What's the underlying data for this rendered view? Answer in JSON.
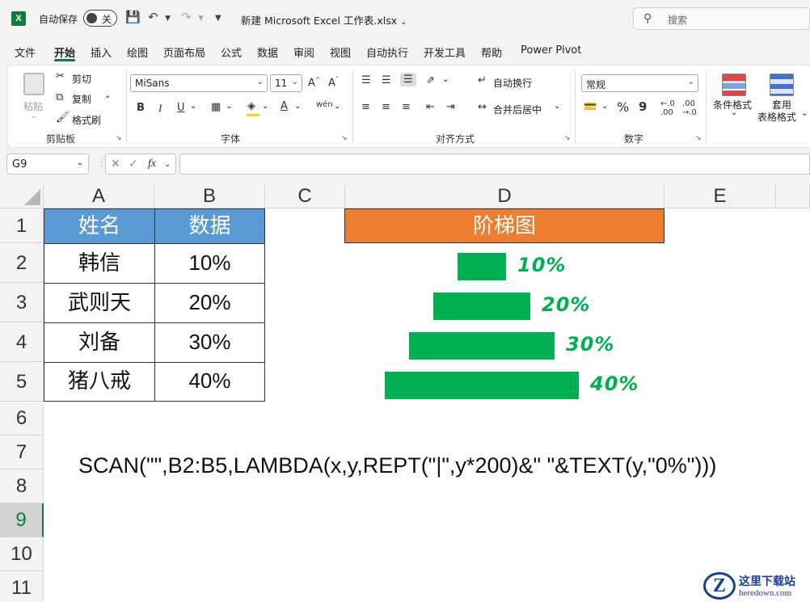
{
  "app": {
    "autosave_label": "自动保存",
    "autosave_state": "关",
    "doc_title": "新建 Microsoft Excel 工作表.xlsx",
    "search_placeholder": "搜索"
  },
  "menu": [
    "文件",
    "开始",
    "插入",
    "绘图",
    "页面布局",
    "公式",
    "数据",
    "审阅",
    "视图",
    "自动执行",
    "开发工具",
    "帮助",
    "Power Pivot"
  ],
  "ribbon": {
    "clipboard": {
      "paste": "粘贴",
      "cut": "剪切",
      "copy": "复制",
      "format_painter": "格式刷",
      "group": "剪贴板"
    },
    "font": {
      "name": "MiSans",
      "size": "11",
      "bold": "B",
      "italic": "I",
      "underline": "U",
      "group": "字体"
    },
    "alignment": {
      "wrap": "自动换行",
      "merge": "合并后居中",
      "group": "对齐方式"
    },
    "number": {
      "format": "常规",
      "percent": "%",
      "comma": "9",
      "group": "数字"
    },
    "styles": {
      "conditional": "条件格式",
      "table1": "套用",
      "table2": "表格格式"
    }
  },
  "formula_bar": {
    "name_box": "G9",
    "fx": "fx",
    "value": ""
  },
  "columns": [
    "A",
    "B",
    "C",
    "D",
    "E"
  ],
  "rows": [
    "1",
    "2",
    "3",
    "4",
    "5",
    "6",
    "7",
    "8",
    "9",
    "10",
    "11"
  ],
  "selected_row": "9",
  "table": {
    "header": [
      "姓名",
      "数据"
    ],
    "rows": [
      [
        "韩信",
        "10%"
      ],
      [
        "武则天",
        "20%"
      ],
      [
        "刘备",
        "30%"
      ],
      [
        "猪八戒",
        "40%"
      ]
    ]
  },
  "ladder": {
    "title": "阶梯图",
    "bar_color": "#00b050",
    "items": [
      {
        "label": "10%",
        "value": 0.1
      },
      {
        "label": "20%",
        "value": 0.2
      },
      {
        "label": "30%",
        "value": 0.3
      },
      {
        "label": "40%",
        "value": 0.4
      }
    ]
  },
  "formula_text": "SCAN(\"\",B2:B5,LAMBDA(x,y,REPT(\"|\",y*200)&\" \"&TEXT(y,\"0%\")))",
  "watermark": {
    "line1": "这里下载站",
    "line2": "heredown.com"
  },
  "colors": {
    "accent": "#107c41",
    "header_blue": "#5b9bd5",
    "title_orange": "#ed7d31"
  }
}
